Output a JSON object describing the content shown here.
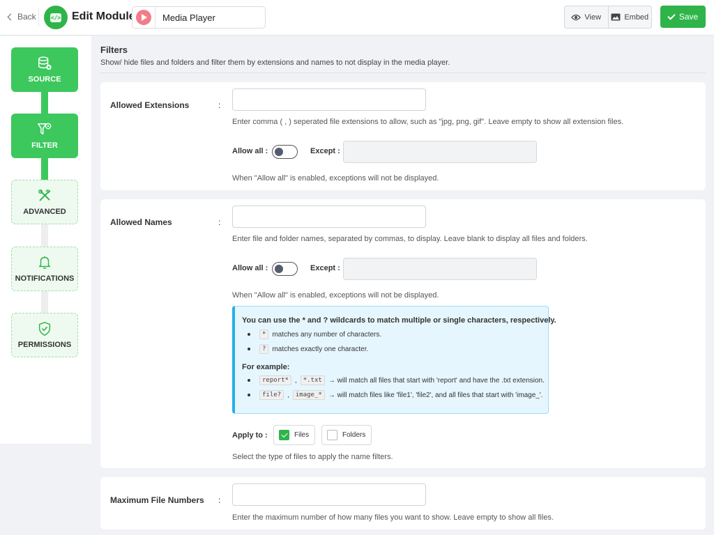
{
  "header": {
    "back_label": "Back",
    "title": "Edit Module",
    "module_name": "Media Player",
    "view_label": "View",
    "embed_label": "Embed",
    "save_label": "Save",
    "accent_color": "#2fb44a"
  },
  "sidebar": {
    "steps": [
      {
        "label": "SOURCE",
        "icon": "database-icon",
        "state": "complete"
      },
      {
        "label": "FILTER",
        "icon": "filter-icon",
        "state": "active"
      },
      {
        "label": "ADVANCED",
        "icon": "tools-icon",
        "state": "pending"
      },
      {
        "label": "NOTIFICATIONS",
        "icon": "bell-icon",
        "state": "pending"
      },
      {
        "label": "PERMISSIONS",
        "icon": "shield-check-icon",
        "state": "pending"
      }
    ]
  },
  "section": {
    "title": "Filters",
    "description": "Show/ hide files and folders and filter them by extensions and names to not display in the media player."
  },
  "extensions": {
    "label": "Allowed Extensions",
    "colon": ":",
    "value": "",
    "hint": "Enter comma ( , ) seperated file extensions to allow, such as \"jpg, png, gif\". Leave empty to show all extension files.",
    "allow_all_label": "Allow all :",
    "allow_all": false,
    "except_label": "Except :",
    "except_value": "",
    "note": "When \"Allow all\" is enabled, exceptions will not be displayed."
  },
  "names": {
    "label": "Allowed Names",
    "colon": ":",
    "value": "",
    "hint": "Enter file and folder names, separated by commas, to display. Leave blank to display all files and folders.",
    "allow_all_label": "Allow all :",
    "allow_all": false,
    "except_label": "Except :",
    "except_value": "",
    "note": "When \"Allow all\" is enabled, exceptions will not be displayed.",
    "info": {
      "heading": "You can use the * and ? wildcards to match multiple or single characters, respectively.",
      "star_code": "*",
      "star_text": "matches any number of characters.",
      "q_code": "?",
      "q_text": "matches exactly one character.",
      "example_heading": "For example:",
      "ex1_code1": "report*",
      "ex1_sep": ",",
      "ex1_code2": "*.txt",
      "ex1_text": "→ will match all files that start with 'report' and have the .txt extension.",
      "ex2_code1": "file?",
      "ex2_sep": ",",
      "ex2_code2": "image_*",
      "ex2_text": "→ will match files like 'file1', 'file2', and all files that start with 'image_'."
    },
    "apply_label": "Apply to :",
    "apply_files_label": "Files",
    "apply_files_checked": true,
    "apply_folders_label": "Folders",
    "apply_folders_checked": false,
    "apply_hint": "Select the type of files to apply the name filters."
  },
  "max_files": {
    "label": "Maximum File Numbers",
    "colon": ":",
    "value": "",
    "hint": "Enter the maximum number of how many files you want to show. Leave empty to show all files."
  }
}
